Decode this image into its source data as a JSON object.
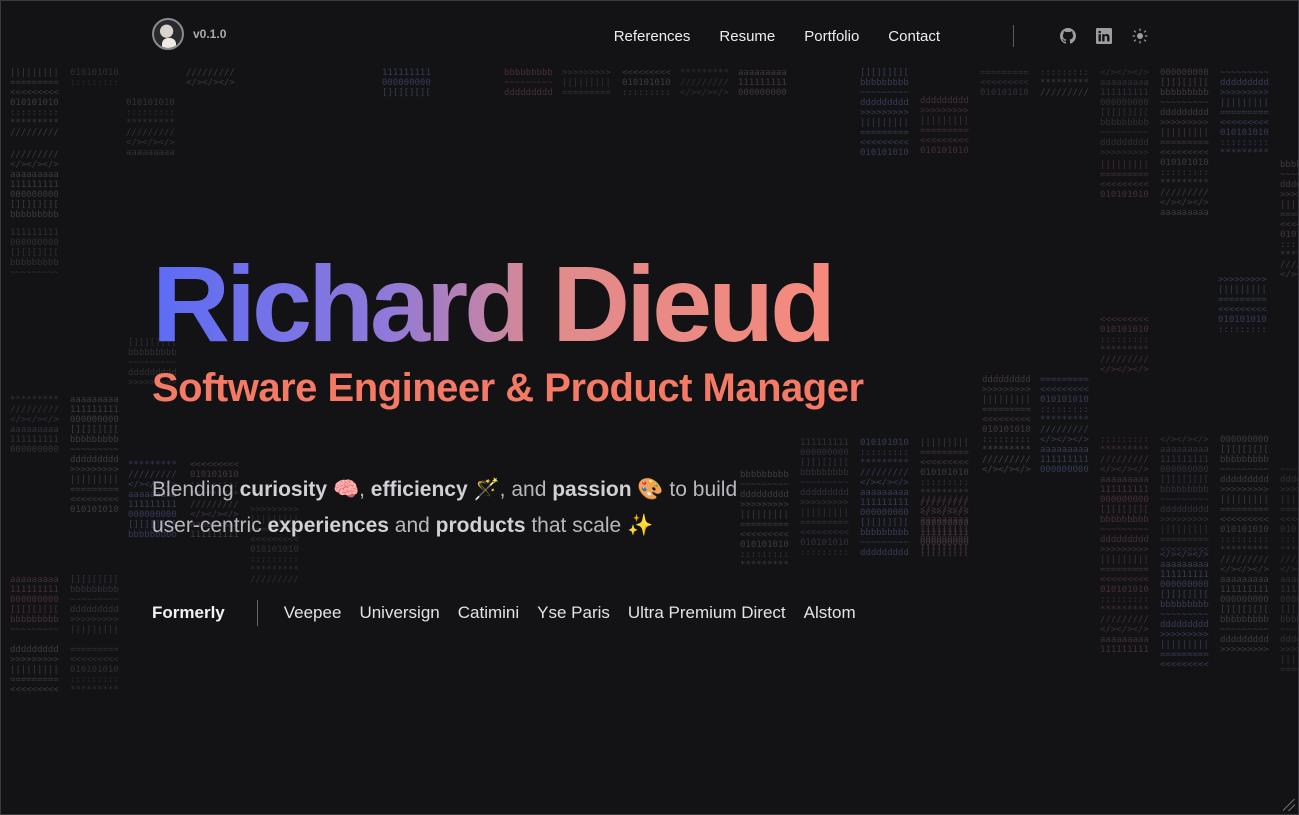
{
  "header": {
    "version": "v0.1.0",
    "nav": [
      "References",
      "Resume",
      "Portfolio",
      "Contact"
    ],
    "icons": [
      "github-icon",
      "linkedin-icon",
      "sun-icon"
    ]
  },
  "hero": {
    "name": "Richard Dieud",
    "role": "Software Engineer & Product Manager"
  },
  "tagline": {
    "t1": "Blending ",
    "w1": "curiosity",
    "e1": "🧠",
    "t2": ", ",
    "w2": "efficiency",
    "e2": "🪄",
    "t3": ", and ",
    "w3": "passion",
    "e3": "🎨",
    "t4": " to build",
    "t5": "user-centric ",
    "w4": "experiences",
    "t6": " and ",
    "w5": "products",
    "t7": " that scale ",
    "e4": "✨"
  },
  "formerly": {
    "label": "Formerly",
    "companies": [
      "Veepee",
      "Universign",
      "Catimini",
      "Yse Paris",
      "Ultra Premium Direct",
      "Alstom"
    ]
  },
  "colors": {
    "background": "#131316",
    "gradient_start": "#5b6cf6",
    "gradient_end": "#f8897a",
    "role": "#f47a66"
  }
}
